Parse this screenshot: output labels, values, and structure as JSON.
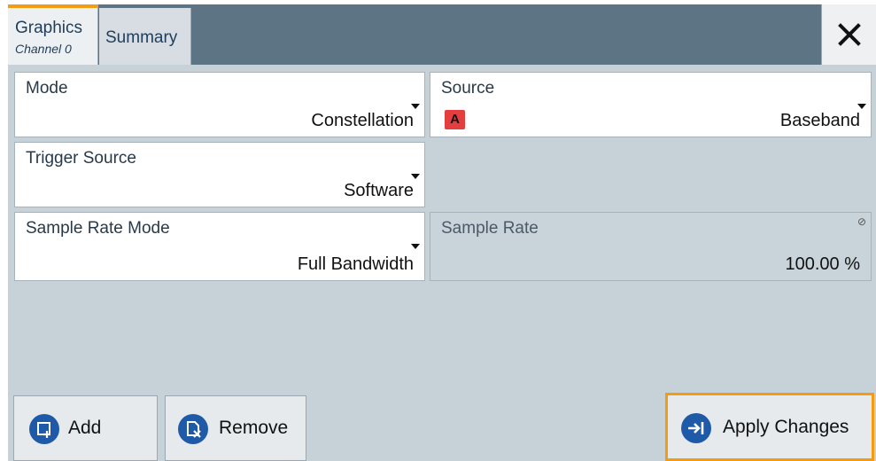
{
  "tabs": [
    {
      "title": "Graphics",
      "subtitle": "Channel 0",
      "active": true
    },
    {
      "title": "Summary",
      "active": false
    }
  ],
  "close_icon": "close-x-icon",
  "fields": {
    "mode": {
      "label": "Mode",
      "value": "Constellation"
    },
    "source": {
      "label": "Source",
      "value": "Baseband",
      "badge": "A"
    },
    "trigger_source": {
      "label": "Trigger Source",
      "value": "Software"
    },
    "sample_rate_mode": {
      "label": "Sample Rate Mode",
      "value": "Full Bandwidth"
    },
    "sample_rate": {
      "label": "Sample Rate",
      "value": "100.00 %",
      "locked": true
    }
  },
  "buttons": {
    "add": {
      "label": "Add",
      "icon": "add-icon"
    },
    "remove": {
      "label": "Remove",
      "icon": "remove-icon"
    },
    "apply": {
      "label": "Apply Changes",
      "icon": "apply-arrow-icon"
    }
  },
  "colors": {
    "accent": "#f39c12",
    "tabbar": "#5d7485",
    "content_bg": "#c7d1d8",
    "icon_blue": "#1f5aa8",
    "badge_red": "#e53e3e"
  }
}
